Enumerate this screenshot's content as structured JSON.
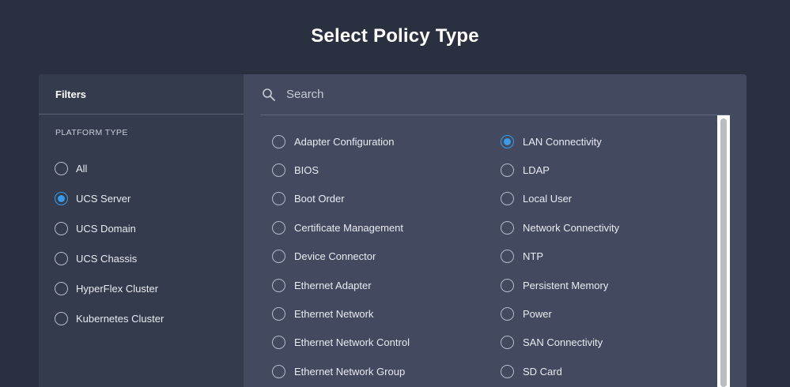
{
  "page": {
    "title": "Select Policy Type"
  },
  "filters": {
    "header": "Filters",
    "section_label": "PLATFORM TYPE",
    "items": [
      {
        "label": "All",
        "checked": false
      },
      {
        "label": "UCS Server",
        "checked": true
      },
      {
        "label": "UCS Domain",
        "checked": false
      },
      {
        "label": "UCS Chassis",
        "checked": false
      },
      {
        "label": "HyperFlex Cluster",
        "checked": false
      },
      {
        "label": "Kubernetes Cluster",
        "checked": false
      }
    ]
  },
  "search": {
    "placeholder": "Search",
    "value": "",
    "icon": "search-icon"
  },
  "policies": {
    "left": [
      {
        "label": "Adapter Configuration",
        "checked": false
      },
      {
        "label": "BIOS",
        "checked": false
      },
      {
        "label": "Boot Order",
        "checked": false
      },
      {
        "label": "Certificate Management",
        "checked": false
      },
      {
        "label": "Device Connector",
        "checked": false
      },
      {
        "label": "Ethernet Adapter",
        "checked": false
      },
      {
        "label": "Ethernet Network",
        "checked": false
      },
      {
        "label": "Ethernet Network Control",
        "checked": false
      },
      {
        "label": "Ethernet Network Group",
        "checked": false
      }
    ],
    "right": [
      {
        "label": "LAN Connectivity",
        "checked": true
      },
      {
        "label": "LDAP",
        "checked": false
      },
      {
        "label": "Local User",
        "checked": false
      },
      {
        "label": "Network Connectivity",
        "checked": false
      },
      {
        "label": "NTP",
        "checked": false
      },
      {
        "label": "Persistent Memory",
        "checked": false
      },
      {
        "label": "Power",
        "checked": false
      },
      {
        "label": "SAN Connectivity",
        "checked": false
      },
      {
        "label": "SD Card",
        "checked": false
      }
    ]
  },
  "colors": {
    "background": "#2a3040",
    "panel": "#343b4d",
    "content": "#434a5f",
    "accent": "#3a9be8"
  }
}
